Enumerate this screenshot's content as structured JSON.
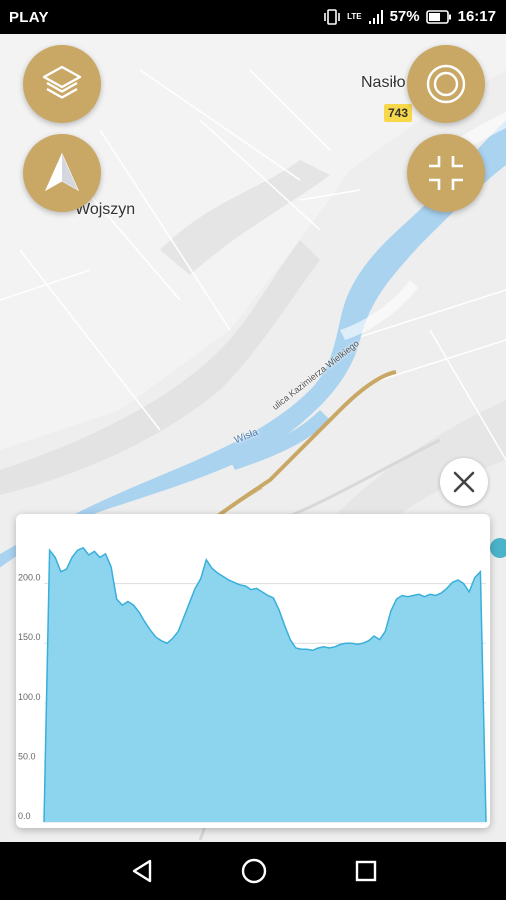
{
  "status_bar": {
    "carrier": "PLAY",
    "battery": "57%",
    "time": "16:17",
    "network": "LTE"
  },
  "map": {
    "places": [
      "Nasiło",
      "Wojszyn"
    ],
    "road_number": "743",
    "river_label": "Wisła",
    "street_label": "ulica Kazimierza Wielkiego"
  },
  "buttons": {
    "layers": "layers-icon",
    "compass": "navigation-arrow-icon",
    "locate": "locate-target-icon",
    "fullscreen": "fullscreen-icon",
    "close": "close-icon"
  },
  "colors": {
    "accent": "#c9a866",
    "water": "#aad3f0",
    "chart_fill": "#8dd5ef",
    "chart_line": "#39afd9",
    "route": "#c9a866"
  },
  "chart_data": {
    "type": "area",
    "title": "",
    "xlabel": "",
    "ylabel": "",
    "ylim": [
      0,
      250
    ],
    "yticks": [
      "0.0",
      "50.0",
      "100.0",
      "150.0",
      "200.0"
    ],
    "values": [
      0,
      228,
      222,
      210,
      212,
      222,
      228,
      230,
      224,
      227,
      222,
      225,
      214,
      187,
      182,
      185,
      182,
      176,
      168,
      161,
      155,
      152,
      150,
      154,
      160,
      172,
      184,
      196,
      204,
      220,
      213,
      209,
      206,
      203,
      201,
      199,
      198,
      195,
      196,
      193,
      190,
      188,
      178,
      165,
      153,
      146,
      145,
      145,
      144,
      146,
      147,
      146,
      147,
      149,
      150,
      150,
      149,
      150,
      152,
      156,
      153,
      160,
      177,
      187,
      190,
      189,
      190,
      191,
      189,
      191,
      190,
      192,
      196,
      201,
      203,
      200,
      193,
      205,
      210,
      0
    ]
  },
  "nav_bar": {
    "back": "back-triangle-icon",
    "home": "home-circle-icon",
    "recents": "recents-square-icon"
  }
}
